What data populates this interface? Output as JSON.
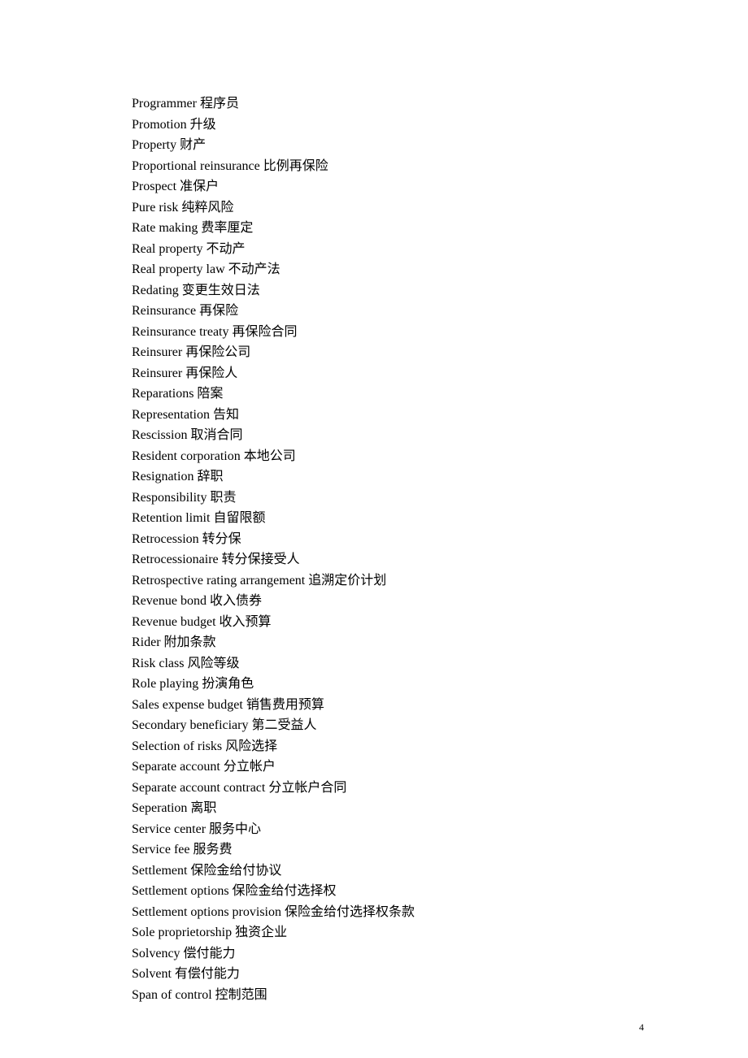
{
  "entries": [
    "Programmer  程序员",
    "Promotion  升级",
    "Property  财产",
    "Proportional reinsurance  比例再保险",
    "Prospect  准保户",
    "Pure risk  纯粹风险",
    "Rate making  费率厘定",
    "Real property  不动产",
    "Real property law  不动产法",
    "Redating  变更生效日法",
    "Reinsurance  再保险",
    "Reinsurance treaty  再保险合同",
    "Reinsurer  再保险公司",
    "Reinsurer  再保险人",
    "Reparations  陪案",
    "Representation  告知",
    "Rescission  取消合同",
    "Resident corporation  本地公司",
    "Resignation  辞职",
    "Responsibility  职责",
    "Retention limit  自留限额",
    "Retrocession  转分保",
    "Retrocessionaire  转分保接受人",
    "Retrospective rating arrangement  追溯定价计划",
    "Revenue bond  收入债券",
    "Revenue budget  收入预算",
    "Rider  附加条款",
    "Risk class  风险等级",
    "Role playing  扮演角色",
    "Sales expense budget  销售费用预算",
    "Secondary beneficiary  第二受益人",
    "Selection of risks  风险选择",
    "Separate account  分立帐户",
    "Separate account contract  分立帐户合同",
    "Seperation  离职",
    "Service center  服务中心",
    "Service fee  服务费",
    "Settlement  保险金给付协议",
    "Settlement options  保险金给付选择权",
    "Settlement options provision  保险金给付选择权条款",
    "Sole proprietorship  独资企业",
    "Solvency  偿付能力",
    "Solvent  有偿付能力",
    "Span of control  控制范围"
  ],
  "pageNumber": "4"
}
